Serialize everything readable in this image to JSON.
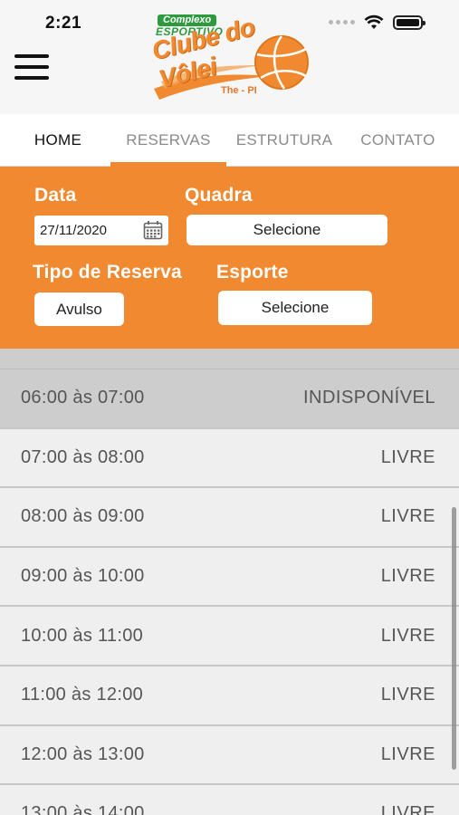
{
  "status_bar": {
    "time": "2:21"
  },
  "logo": {
    "line1": "Complexo",
    "line2": "ESPORTIVO",
    "line3": "Clube do Vôlei",
    "line4": "The - PI"
  },
  "tabs": [
    {
      "label": "HOME"
    },
    {
      "label": "RESERVAS"
    },
    {
      "label": "ESTRUTURA"
    },
    {
      "label": "CONTATO"
    }
  ],
  "filters": {
    "data_label": "Data",
    "data_value": "27/11/2020",
    "quadra_label": "Quadra",
    "quadra_value": "Selecione",
    "tipo_label": "Tipo de Reserva",
    "tipo_value": "Avulso",
    "esporte_label": "Esporte",
    "esporte_value": "Selecione"
  },
  "slots": [
    {
      "time": "06:00 às 07:00",
      "status": "INDISPONÍVEL"
    },
    {
      "time": "07:00 às 08:00",
      "status": "LIVRE"
    },
    {
      "time": "08:00 às 09:00",
      "status": "LIVRE"
    },
    {
      "time": "09:00 às 10:00",
      "status": "LIVRE"
    },
    {
      "time": "10:00 às 11:00",
      "status": "LIVRE"
    },
    {
      "time": "11:00 às 12:00",
      "status": "LIVRE"
    },
    {
      "time": "12:00 às 13:00",
      "status": "LIVRE"
    },
    {
      "time": "13:00 às 14:00",
      "status": "LIVRE"
    }
  ],
  "colors": {
    "accent": "#f0892f",
    "brand_green": "#2e9a3e",
    "unavailable_row": "#cdcdcd"
  },
  "icons": {
    "menu": "hamburger-menu-icon",
    "calendar": "calendar-icon",
    "wifi": "wifi-icon",
    "battery": "battery-icon",
    "signal": "signal-icon"
  }
}
